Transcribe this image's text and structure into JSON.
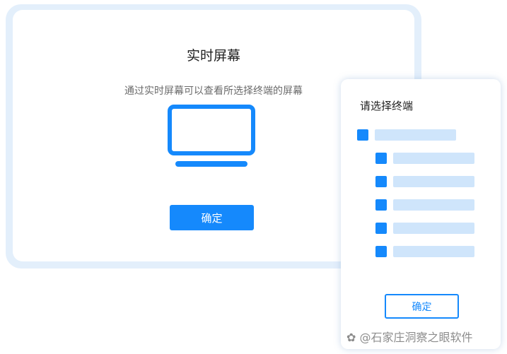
{
  "main_dialog": {
    "title": "实时屏幕",
    "subtitle": "通过实时屏幕可以查看所选择终端的屏幕",
    "icon": "monitor-icon",
    "confirm_label": "确定"
  },
  "terminal_panel": {
    "title": "请选择终端",
    "items_count_note": "",
    "confirm_label": "确定"
  },
  "watermark": {
    "text": "@石家庄洞察之眼软件"
  },
  "colors": {
    "accent": "#1589fc",
    "placeholder_bar": "#cfe5fb",
    "dialog_border": "#e3effb"
  }
}
